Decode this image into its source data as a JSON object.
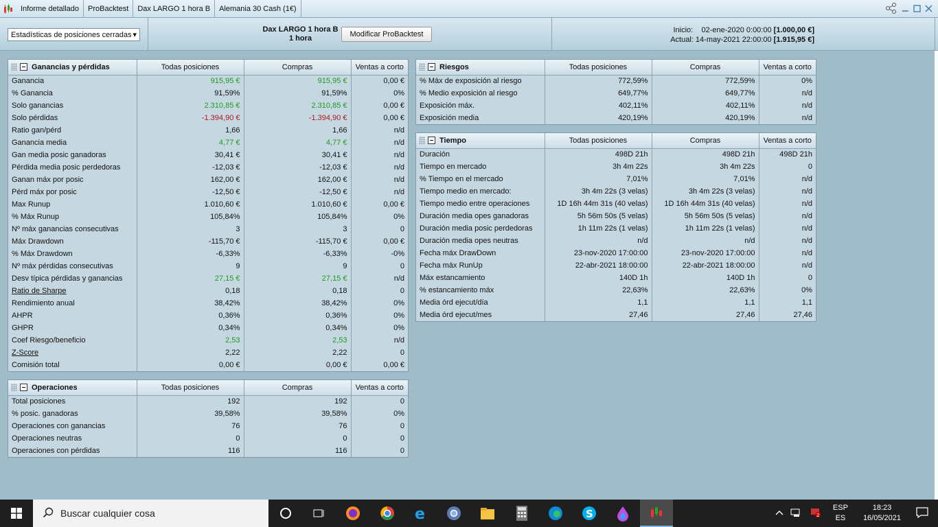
{
  "titlebar": {
    "tabs": [
      "Informe detallado",
      "ProBacktest",
      "Dax LARGO 1 hora B",
      "Alemania 30 Cash (1€)"
    ]
  },
  "header": {
    "dropdown": "Estadísticas de posiciones cerradas",
    "strategy_name": "Dax LARGO 1 hora B",
    "timeframe": "1 hora",
    "modify_button": "Modificar ProBacktest",
    "start_label": "Inicio:",
    "start_date": "02-ene-2020 0:00:00",
    "start_value": "[1.000,00 €]",
    "current_label": "Actual:",
    "current_date": "14-may-2021 22:00:00",
    "current_value": "[1.915,95 €]"
  },
  "columns": [
    "Todas posiciones",
    "Compras",
    "Ventas a corto"
  ],
  "colors": {
    "positive": "#1f9a1f",
    "negative": "#b01818",
    "panel_bg": "#c5d7e0",
    "app_bg": "#9fbcc8"
  },
  "panels": {
    "pnl": {
      "title": "Ganancias y pérdidas",
      "rows": [
        {
          "label": "Ganancia",
          "v": [
            "915,95 €",
            "915,95 €",
            "0,00 €"
          ],
          "c": "pos"
        },
        {
          "label": "% Ganancia",
          "v": [
            "91,59%",
            "91,59%",
            "0%"
          ]
        },
        {
          "label": "Solo ganancias",
          "v": [
            "2.310,85 €",
            "2.310,85 €",
            "0,00 €"
          ],
          "c": "pos"
        },
        {
          "label": "Solo pérdidas",
          "v": [
            "-1.394,90 €",
            "-1.394,90 €",
            "0,00 €"
          ],
          "c": "neg"
        },
        {
          "label": "Ratio gan/pérd",
          "v": [
            "1,66",
            "1,66",
            "n/d"
          ]
        },
        {
          "label": "Ganancia media",
          "v": [
            "4,77 €",
            "4,77 €",
            "n/d"
          ],
          "c": "pos"
        },
        {
          "label": "Gan media posic ganadoras",
          "v": [
            "30,41 €",
            "30,41 €",
            "n/d"
          ]
        },
        {
          "label": "Pérdida media posic perdedoras",
          "v": [
            "-12,03 €",
            "-12,03 €",
            "n/d"
          ]
        },
        {
          "label": "Ganan máx por posic",
          "v": [
            "162,00 €",
            "162,00 €",
            "n/d"
          ]
        },
        {
          "label": "Pérd máx por posic",
          "v": [
            "-12,50 €",
            "-12,50 €",
            "n/d"
          ]
        },
        {
          "label": "Max Runup",
          "v": [
            "1.010,60 €",
            "1.010,60 €",
            "0,00 €"
          ]
        },
        {
          "label": "% Máx Runup",
          "v": [
            "105,84%",
            "105,84%",
            "0%"
          ]
        },
        {
          "label": "Nº máx ganancias consecutivas",
          "v": [
            "3",
            "3",
            "0"
          ]
        },
        {
          "label": "Máx Drawdown",
          "v": [
            "-115,70 €",
            "-115,70 €",
            "0,00 €"
          ]
        },
        {
          "label": "% Máx Drawdown",
          "v": [
            "-6,33%",
            "-6,33%",
            "-0%"
          ]
        },
        {
          "label": "Nº máx pérdidas consecutivas",
          "v": [
            "9",
            "9",
            "0"
          ]
        },
        {
          "label": "Desv típica pérdidas y ganancias",
          "v": [
            "27,15 €",
            "27,15 €",
            "n/d"
          ],
          "c": "pos"
        },
        {
          "label": "Ratio de Sharpe",
          "v": [
            "0,18",
            "0,18",
            "0"
          ],
          "u": true
        },
        {
          "label": "Rendimiento anual",
          "v": [
            "38,42%",
            "38,42%",
            "0%"
          ]
        },
        {
          "label": "AHPR",
          "v": [
            "0,36%",
            "0,36%",
            "0%"
          ]
        },
        {
          "label": "GHPR",
          "v": [
            "0,34%",
            "0,34%",
            "0%"
          ]
        },
        {
          "label": "Coef Riesgo/beneficio",
          "v": [
            "2,53",
            "2,53",
            "n/d"
          ],
          "c": "pos"
        },
        {
          "label": "Z-Score",
          "v": [
            "2,22",
            "2,22",
            "0"
          ],
          "u": true
        },
        {
          "label": "Comisión total",
          "v": [
            "0,00 €",
            "0,00 €",
            "0,00 €"
          ]
        }
      ]
    },
    "ops": {
      "title": "Operaciones",
      "rows": [
        {
          "label": "Total posiciones",
          "v": [
            "192",
            "192",
            "0"
          ]
        },
        {
          "label": "% posic. ganadoras",
          "v": [
            "39,58%",
            "39,58%",
            "0%"
          ]
        },
        {
          "label": "Operaciones con ganancias",
          "v": [
            "76",
            "76",
            "0"
          ]
        },
        {
          "label": "Operaciones neutras",
          "v": [
            "0",
            "0",
            "0"
          ]
        },
        {
          "label": "Operaciones con pérdidas",
          "v": [
            "116",
            "116",
            "0"
          ]
        }
      ]
    },
    "risk": {
      "title": "Riesgos",
      "rows": [
        {
          "label": "% Máx de exposición al riesgo",
          "v": [
            "772,59%",
            "772,59%",
            "0%"
          ]
        },
        {
          "label": "% Medio exposición al riesgo",
          "v": [
            "649,77%",
            "649,77%",
            "n/d"
          ]
        },
        {
          "label": "Exposición máx.",
          "v": [
            "402,11%",
            "402,11%",
            "n/d"
          ]
        },
        {
          "label": "Exposición media",
          "v": [
            "420,19%",
            "420,19%",
            "n/d"
          ]
        }
      ]
    },
    "time": {
      "title": "Tiempo",
      "rows": [
        {
          "label": "Duración",
          "v": [
            "498D 21h",
            "498D 21h",
            "498D 21h"
          ]
        },
        {
          "label": "Tiempo en mercado",
          "v": [
            "3h 4m 22s",
            "3h 4m 22s",
            "0"
          ]
        },
        {
          "label": "% Tiempo en el mercado",
          "v": [
            "7,01%",
            "7,01%",
            "n/d"
          ]
        },
        {
          "label": "Tiempo medio en mercado:",
          "v": [
            "3h 4m 22s (3 velas)",
            "3h 4m 22s (3 velas)",
            "n/d"
          ]
        },
        {
          "label": "Tiempo medio entre operaciones",
          "v": [
            "1D 16h 44m 31s (40 velas)",
            "1D 16h 44m 31s (40 velas)",
            "n/d"
          ]
        },
        {
          "label": "Duración media opes ganadoras",
          "v": [
            "5h 56m 50s (5 velas)",
            "5h 56m 50s (5 velas)",
            "n/d"
          ]
        },
        {
          "label": "Duración media posic perdedoras",
          "v": [
            "1h 11m 22s (1 velas)",
            "1h 11m 22s (1 velas)",
            "n/d"
          ]
        },
        {
          "label": "Duración media opes neutras",
          "v": [
            "n/d",
            "n/d",
            "n/d"
          ]
        },
        {
          "label": "Fecha máx DrawDown",
          "v": [
            "23-nov-2020 17:00:00",
            "23-nov-2020 17:00:00",
            "n/d"
          ]
        },
        {
          "label": "Fecha máx RunUp",
          "v": [
            "22-abr-2021 18:00:00",
            "22-abr-2021 18:00:00",
            "n/d"
          ]
        },
        {
          "label": "Máx estancamiento",
          "v": [
            "140D 1h",
            "140D 1h",
            "0"
          ]
        },
        {
          "label": "% estancamiento máx",
          "v": [
            "22,63%",
            "22,63%",
            "0%"
          ]
        },
        {
          "label": "Media órd ejecut/día",
          "v": [
            "1,1",
            "1,1",
            "1,1"
          ]
        },
        {
          "label": "Media órd ejecut/mes",
          "v": [
            "27,46",
            "27,46",
            "27,46"
          ]
        }
      ]
    }
  },
  "taskbar": {
    "search_placeholder": "Buscar cualquier cosa",
    "lang_top": "ESP",
    "lang_bottom": "ES",
    "time": "18:23",
    "date": "16/05/2021",
    "apps": [
      "cortana-icon",
      "task-view-icon",
      "firefox-icon",
      "chrome-icon",
      "internet-explorer-icon",
      "chrome-alt-icon",
      "file-explorer-icon",
      "calculator-icon",
      "edge-icon",
      "skype-icon",
      "paint-drop-icon",
      "prorealtime-icon"
    ]
  }
}
